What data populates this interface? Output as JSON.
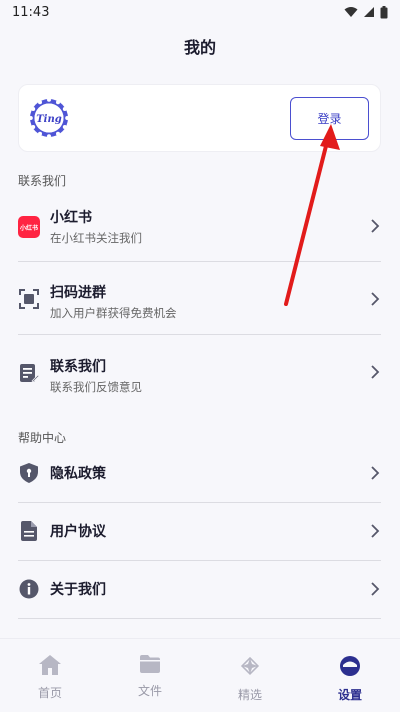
{
  "status_bar": {
    "time": "11:43"
  },
  "header": {
    "title": "我的"
  },
  "profile": {
    "logo_text": "Ting",
    "login_label": "登录"
  },
  "sections": {
    "contact_title": "联系我们",
    "help_title": "帮助中心"
  },
  "contact_items": [
    {
      "label": "小红书",
      "sub": "在小红书关注我们",
      "icon_text": "小红书"
    },
    {
      "label": "扫码进群",
      "sub": "加入用户群获得免费机会"
    },
    {
      "label": "联系我们",
      "sub": "联系我们反馈意见"
    }
  ],
  "help_items": [
    {
      "label": "隐私政策"
    },
    {
      "label": "用户协议"
    },
    {
      "label": "关于我们"
    }
  ],
  "tabs": [
    {
      "label": "首页",
      "icon": "home-icon"
    },
    {
      "label": "文件",
      "icon": "folder-icon"
    },
    {
      "label": "精选",
      "icon": "sparkle-icon"
    },
    {
      "label": "设置",
      "icon": "settings-icon",
      "active": true
    }
  ],
  "colors": {
    "accent": "#3c40c6",
    "xiaohongshu_red": "#ff2442",
    "icon_gray": "#55576a",
    "annotation_red": "#e21b1b"
  }
}
